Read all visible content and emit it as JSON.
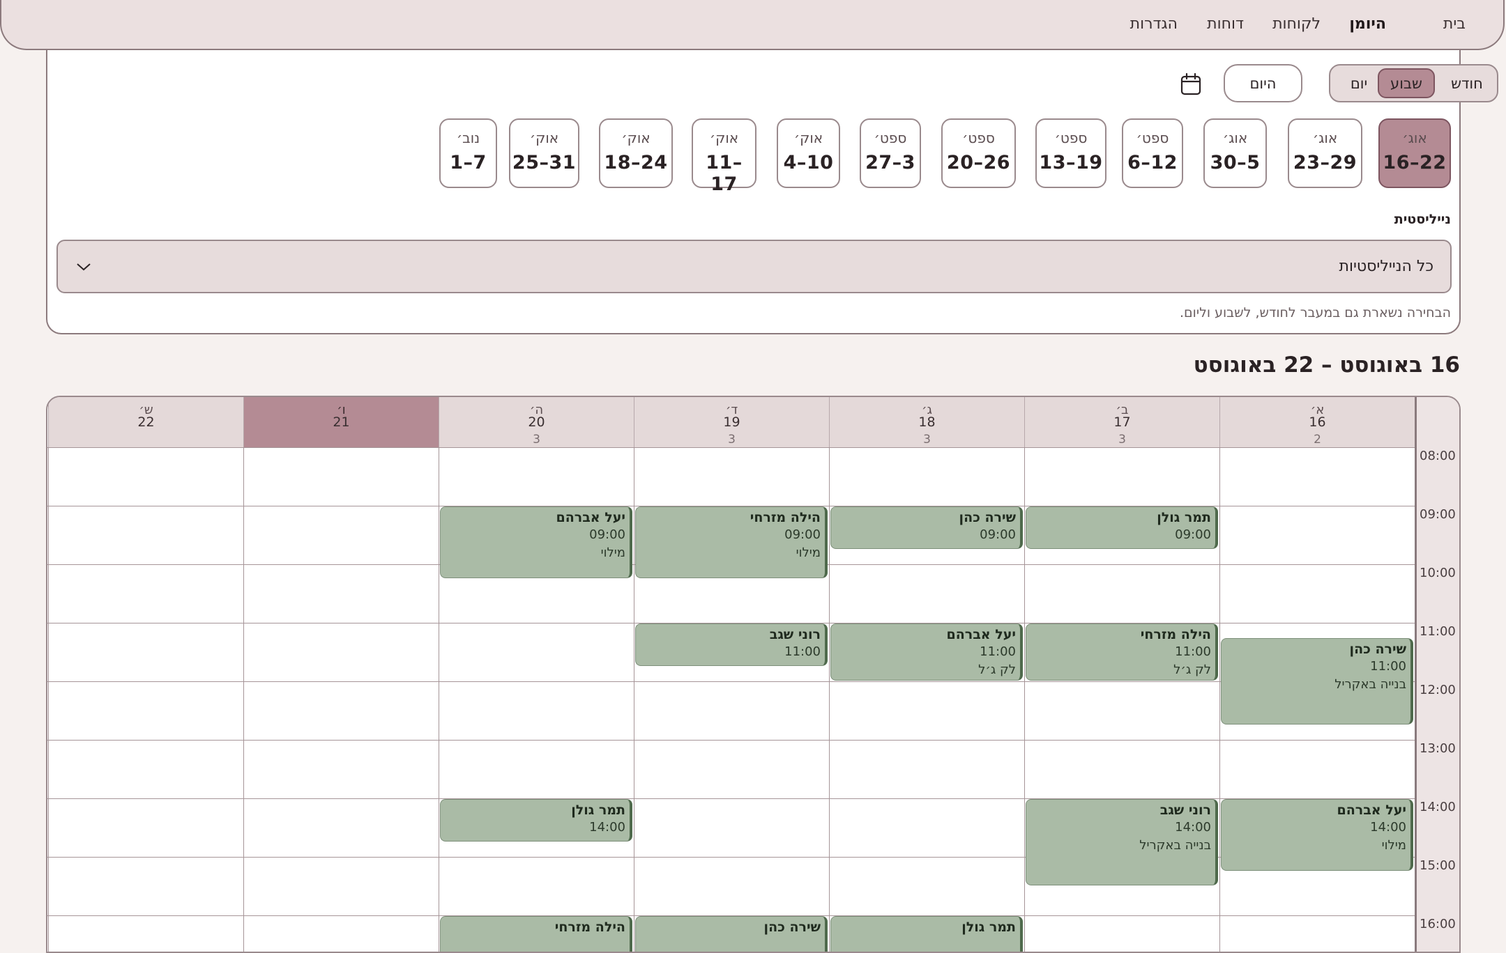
{
  "nav": {
    "items": [
      {
        "label": "בית",
        "active": false
      },
      {
        "label": "היומן",
        "active": true
      },
      {
        "label": "לקוחות",
        "active": false
      },
      {
        "label": "דוחות",
        "active": false
      },
      {
        "label": "הגדרות",
        "active": false
      }
    ]
  },
  "view_toggle": {
    "month": "חודש",
    "week": "שבוע",
    "day": "יום",
    "selected": "week"
  },
  "today_button": "היום",
  "weeks": [
    {
      "month": "אוג׳",
      "range": "16–22",
      "active": true
    },
    {
      "month": "אוג׳",
      "range": "23–29",
      "active": false
    },
    {
      "month": "אוג׳",
      "range": "30–5",
      "active": false
    },
    {
      "month": "ספט׳",
      "range": "6–12",
      "active": false
    },
    {
      "month": "ספט׳",
      "range": "13–19",
      "active": false
    },
    {
      "month": "ספט׳",
      "range": "20–26",
      "active": false
    },
    {
      "month": "ספט׳",
      "range": "27–3",
      "active": false
    },
    {
      "month": "אוק׳",
      "range": "4–10",
      "active": false
    },
    {
      "month": "אוק׳",
      "range": "11–17",
      "active": false
    },
    {
      "month": "אוק׳",
      "range": "18–24",
      "active": false
    },
    {
      "month": "אוק׳",
      "range": "25–31",
      "active": false
    },
    {
      "month": "נוב׳",
      "range": "1–7",
      "active": false
    }
  ],
  "filter": {
    "label": "נייליסטית",
    "value": "כל הנייליסטיות",
    "hint": "הבחירה נשארת גם במעבר לחודש, לשבוע וליום."
  },
  "range_title": "16 באוגוסט – 22 באוגוסט",
  "times": [
    "08:00",
    "09:00",
    "10:00",
    "11:00",
    "12:00",
    "13:00",
    "14:00",
    "15:00",
    "16:00"
  ],
  "days": [
    {
      "name": "א׳",
      "date": "16",
      "count": "2",
      "today": false
    },
    {
      "name": "ב׳",
      "date": "17",
      "count": "3",
      "today": false
    },
    {
      "name": "ג׳",
      "date": "18",
      "count": "3",
      "today": false
    },
    {
      "name": "ד׳",
      "date": "19",
      "count": "3",
      "today": false
    },
    {
      "name": "ה׳",
      "date": "20",
      "count": "3",
      "today": false
    },
    {
      "name": "ו׳",
      "date": "21",
      "count": "",
      "today": true
    },
    {
      "name": "ש׳",
      "date": "22",
      "count": "",
      "today": false
    }
  ],
  "appointments": [
    {
      "day": 0,
      "start": 11.25,
      "end": 12.75,
      "name": "שירה כהן",
      "time": "11:00",
      "service": "בנייה באקריל"
    },
    {
      "day": 0,
      "start": 14.0,
      "end": 15.25,
      "name": "יעל אברהם",
      "time": "14:00",
      "service": "מילוי"
    },
    {
      "day": 1,
      "start": 9.0,
      "end": 9.75,
      "name": "תמר גולן",
      "time": "09:00",
      "service": ""
    },
    {
      "day": 1,
      "start": 11.0,
      "end": 12.0,
      "name": "הילה מזרחי",
      "time": "11:00",
      "service": "לק ג׳ל"
    },
    {
      "day": 1,
      "start": 14.0,
      "end": 15.5,
      "name": "רוני שגב",
      "time": "14:00",
      "service": "בנייה באקריל"
    },
    {
      "day": 2,
      "start": 9.0,
      "end": 9.75,
      "name": "שירה כהן",
      "time": "09:00",
      "service": ""
    },
    {
      "day": 2,
      "start": 11.0,
      "end": 12.0,
      "name": "יעל אברהם",
      "time": "11:00",
      "service": "לק ג׳ל"
    },
    {
      "day": 2,
      "start": 16.0,
      "end": 17.0,
      "name": "תמר גולן",
      "time": "",
      "service": ""
    },
    {
      "day": 3,
      "start": 9.0,
      "end": 10.25,
      "name": "הילה מזרחי",
      "time": "09:00",
      "service": "מילוי"
    },
    {
      "day": 3,
      "start": 11.0,
      "end": 11.75,
      "name": "רוני שגב",
      "time": "11:00",
      "service": ""
    },
    {
      "day": 3,
      "start": 16.0,
      "end": 17.0,
      "name": "שירה כהן",
      "time": "",
      "service": ""
    },
    {
      "day": 4,
      "start": 9.0,
      "end": 10.25,
      "name": "יעל אברהם",
      "time": "09:00",
      "service": "מילוי"
    },
    {
      "day": 4,
      "start": 14.0,
      "end": 14.75,
      "name": "תמר גולן",
      "time": "14:00",
      "service": ""
    },
    {
      "day": 4,
      "start": 16.0,
      "end": 17.0,
      "name": "הילה מזרחי",
      "time": "",
      "service": ""
    }
  ]
}
